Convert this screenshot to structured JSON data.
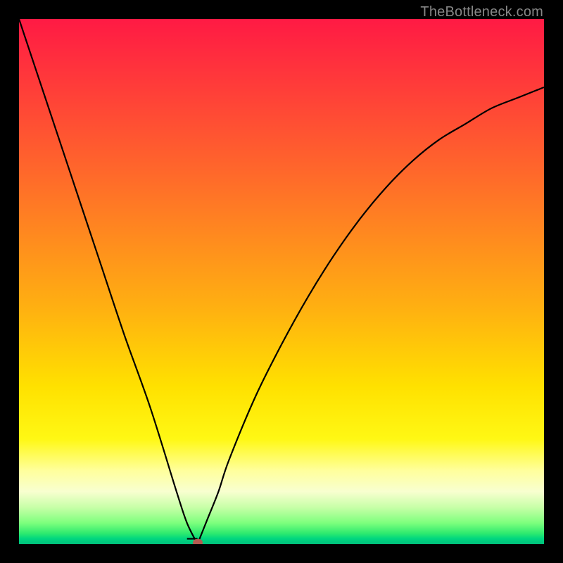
{
  "attribution": "TheBottleneck.com",
  "colors": {
    "frame": "#000000",
    "text": "#878787",
    "curve": "#000000",
    "dot": "#b45a50"
  },
  "chart_data": {
    "type": "line",
    "title": "",
    "xlabel": "",
    "ylabel": "",
    "xlim": [
      0,
      100
    ],
    "ylim": [
      0,
      100
    ],
    "annotations": [],
    "dot": {
      "x": 34,
      "y": 0
    },
    "series": [
      {
        "name": "bottleneck-curve",
        "x": [
          0,
          5,
          10,
          15,
          20,
          25,
          30,
          32,
          34,
          36,
          38,
          40,
          45,
          50,
          55,
          60,
          65,
          70,
          75,
          80,
          85,
          90,
          95,
          100
        ],
        "values": [
          100,
          85,
          70,
          55,
          40,
          26,
          10,
          4,
          0,
          5,
          10,
          16,
          28,
          38,
          47,
          55,
          62,
          68,
          73,
          77,
          80,
          83,
          85,
          87
        ]
      }
    ],
    "gradient_stops": [
      {
        "pos": 0,
        "color": "#ff1a44"
      },
      {
        "pos": 12,
        "color": "#ff3a3a"
      },
      {
        "pos": 30,
        "color": "#ff6a2a"
      },
      {
        "pos": 55,
        "color": "#ffb011"
      },
      {
        "pos": 70,
        "color": "#ffe100"
      },
      {
        "pos": 80,
        "color": "#fff814"
      },
      {
        "pos": 86,
        "color": "#ffff9c"
      },
      {
        "pos": 90,
        "color": "#f8ffd0"
      },
      {
        "pos": 93,
        "color": "#c8ffa8"
      },
      {
        "pos": 96,
        "color": "#7dff7d"
      },
      {
        "pos": 98,
        "color": "#2dea6f"
      },
      {
        "pos": 99,
        "color": "#00d67f"
      },
      {
        "pos": 100,
        "color": "#00c07c"
      }
    ]
  }
}
